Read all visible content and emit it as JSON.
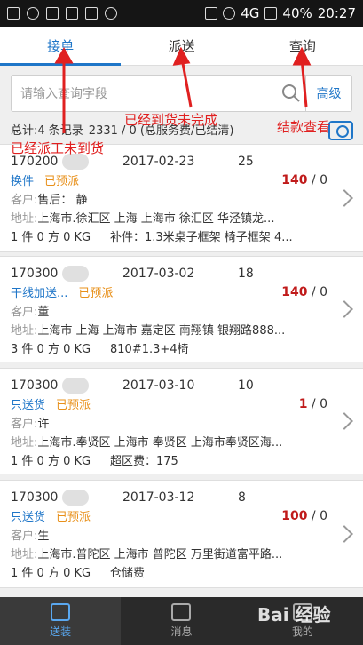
{
  "status_bar": {
    "battery": "40%",
    "time": "20:27",
    "network": "4G"
  },
  "tabs": [
    {
      "label": "接单"
    },
    {
      "label": "派送"
    },
    {
      "label": "查询"
    }
  ],
  "search": {
    "placeholder": "请输入查询字段",
    "advanced_label": "高级"
  },
  "summary": {
    "count_text": "总计:4 条记录",
    "stats_text": "2331 / 0 (总服务费/已结清)"
  },
  "annotations": {
    "dispatched": "已经派工未到货",
    "delivered": "已经到货未完成",
    "settled": "结款查看"
  },
  "orders": [
    {
      "order_no": "170200",
      "date": "2017-02-23",
      "qty": "25",
      "type": "换件",
      "status": "已预派",
      "fee_total": "140",
      "fee_sep": " / ",
      "fee_paid": "0",
      "customer_label": "客户:",
      "customer_value": "售后：  静",
      "address_label": "地址:",
      "address_value": "上海市.徐汇区 上海 上海市 徐汇区 华泾镇龙...",
      "metrics": "1 件  0 方  0 KG",
      "extra": "补件：1.3米桌子框架 椅子框架 4..."
    },
    {
      "order_no": "170300",
      "date": "2017-03-02",
      "qty": "18",
      "type": "干线加送...",
      "status": "已预派",
      "fee_total": "140",
      "fee_sep": " / ",
      "fee_paid": "0",
      "customer_label": "客户:",
      "customer_value": "董",
      "address_label": "地址:",
      "address_value": "上海市 上海 上海市 嘉定区 南翔镇 银翔路888...",
      "metrics": "3 件  0 方  0 KG",
      "extra": "810#1.3+4椅"
    },
    {
      "order_no": "170300",
      "date": "2017-03-10",
      "qty": "10",
      "type": "只送货",
      "status": "已预派",
      "fee_total": "1",
      "fee_sep": " / ",
      "fee_paid": "0",
      "customer_label": "客户:",
      "customer_value": "许",
      "address_label": "地址:",
      "address_value": "上海市.奉贤区 上海市 奉贤区 上海市奉贤区海...",
      "metrics": "1 件  0 方  0 KG",
      "extra": "超区费：175"
    },
    {
      "order_no": "170300",
      "date": "2017-03-12",
      "qty": "8",
      "type": "只送货",
      "status": "已预派",
      "fee_total": "100",
      "fee_sep": " / ",
      "fee_paid": "0",
      "customer_label": "客户:",
      "customer_value": "生",
      "address_label": "地址:",
      "address_value": "上海市.普陀区 上海市 普陀区 万里街道富平路...",
      "metrics": "1 件  0 方  0 KG",
      "extra": "仓储费"
    }
  ],
  "bottom_nav": [
    {
      "label": "送装"
    },
    {
      "label": "消息"
    },
    {
      "label": "我的"
    }
  ],
  "watermark": "Bai 经验",
  "colors": {
    "accent": "#1f76c8",
    "status_orange": "#e8901a",
    "fee_red": "#c01a1a",
    "annotation_red": "#e02020"
  }
}
